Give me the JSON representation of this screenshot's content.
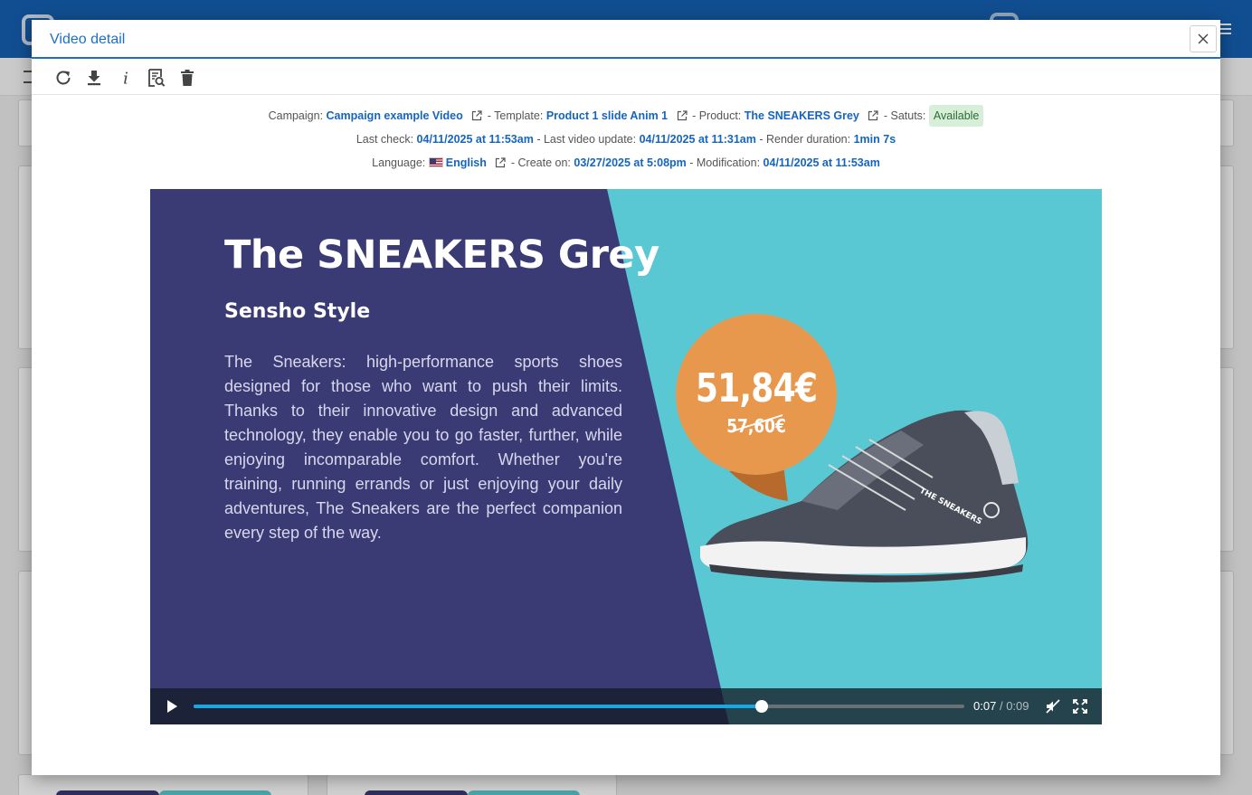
{
  "modal": {
    "title": "Video detail"
  },
  "toolbar": {
    "buttons": [
      {
        "icon": "refresh-icon"
      },
      {
        "icon": "download-icon"
      },
      {
        "icon": "info-icon"
      },
      {
        "icon": "document-search-icon"
      },
      {
        "icon": "trash-icon"
      }
    ]
  },
  "meta": {
    "campaign_label": "Campaign:",
    "campaign_value": "Campaign example Video",
    "template_label": "- Template:",
    "template_value": "Product 1 slide Anim 1",
    "product_label": "- Product:",
    "product_value": "The SNEAKERS Grey",
    "status_label": "- Satuts:",
    "status_value": "Available",
    "last_check_label": "Last check:",
    "last_check_value": "04/11/2025 at 11:53am",
    "last_update_label": "- Last video update:",
    "last_update_value": "04/11/2025 at 11:31am",
    "render_label": "- Render duration:",
    "render_value": "1min 7s",
    "language_label": "Language:",
    "language_value": "English",
    "create_label": "- Create on:",
    "create_value": "03/27/2025 at 5:08pm",
    "modification_label": "- Modification:",
    "modification_value": "04/11/2025 at 11:53am"
  },
  "video": {
    "title": "The SNEAKERS Grey",
    "subtitle": "Sensho Style",
    "description": "The Sneakers: high-performance sports shoes designed for those who want to push their limits. Thanks to their innovative design and advanced technology, they enable you to go faster, further, while enjoying incomparable comfort. Whether you're training, running errands or just enjoying your daily adventures, The Sneakers are the perfect companion every step of the way.",
    "price": "51,84€",
    "old_price": "57,60€",
    "shoe_brand_text": "THE SNEAKERS",
    "current_time": "0:07",
    "time_separator": "/",
    "duration": "0:09",
    "progress": 0.737
  },
  "colors": {
    "header_blue": "#1560b1",
    "accent": "#1d6fc4",
    "link": "#1565c0",
    "badge_bg": "#d7efd9",
    "video_navy": "#3a3a75",
    "video_teal": "#5ac8d2",
    "price_orange": "#e8984d",
    "progress": "#12a9e6"
  }
}
